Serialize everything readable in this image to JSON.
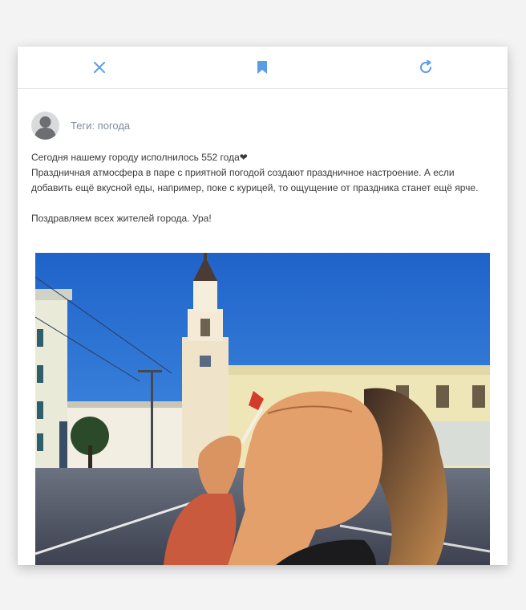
{
  "toolbar": {
    "close_icon": "close-icon",
    "bookmark_icon": "bookmark-icon",
    "share_icon": "share-icon",
    "accent_color": "#5c9ce6"
  },
  "post": {
    "tags": "Теги: погода",
    "lines": [
      "Сегодня нашему городу исполнилось 552 года❤",
      "Праздничная атмосфера в паре с приятной погодой создают праздничное настроение. А если добавить ещё вкусной еды, например, поке с курицей, то ощущение от праздника станет ещё ярче."
    ],
    "closing": "Поздравляем всех жителей города. Ура!"
  }
}
